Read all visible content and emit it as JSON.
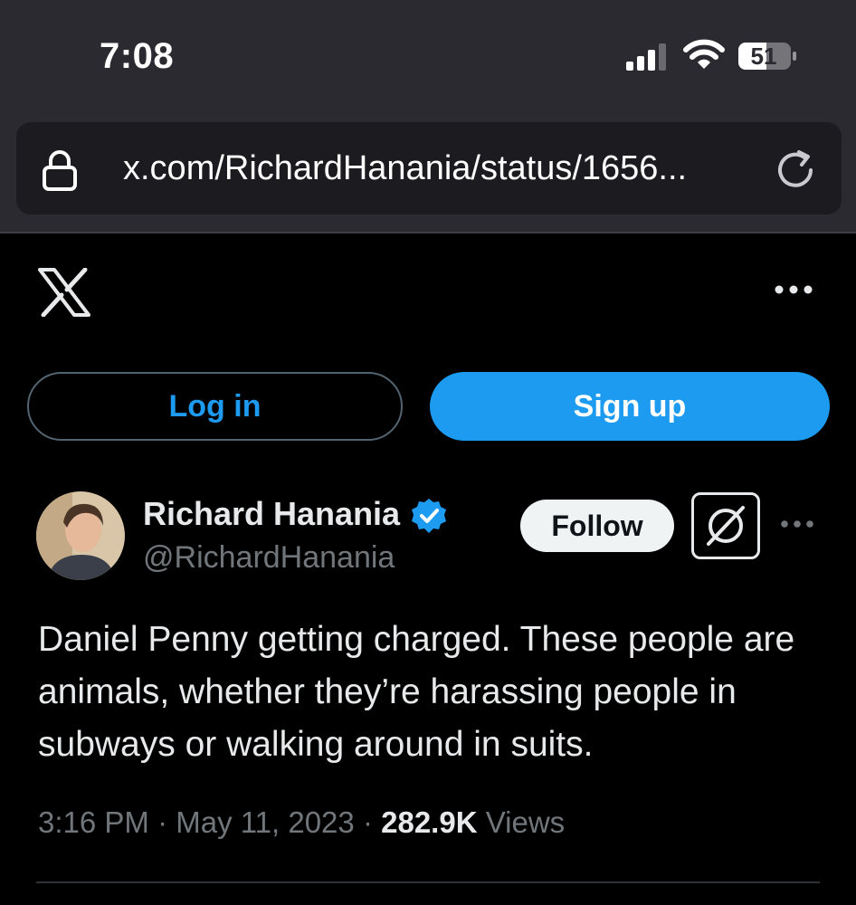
{
  "status_bar": {
    "time": "7:08",
    "battery_level": "51"
  },
  "browser": {
    "url": "x.com/RichardHanania/status/1656..."
  },
  "header": {
    "logo": "x-logo-icon",
    "more": "more-icon"
  },
  "auth": {
    "login_label": "Log in",
    "signup_label": "Sign up"
  },
  "post": {
    "display_name": "Richard Hanania",
    "handle": "@RichardHanania",
    "follow_label": "Follow",
    "text": "Daniel Penny getting charged. These people are animals, whether they’re harassing people in subways or walking around in suits.",
    "time": "3:16 PM",
    "separator": "·",
    "date": "May 11, 2023",
    "views_count": "282.9K",
    "views_label": "Views"
  },
  "colors": {
    "accent": "#1d9bf0",
    "background": "#000000",
    "chrome": "#2b2a30",
    "muted_text": "#71767b"
  }
}
